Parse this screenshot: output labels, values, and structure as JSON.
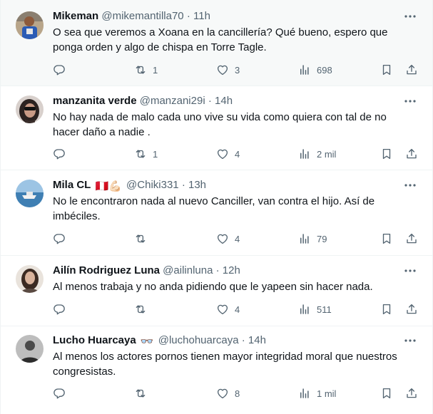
{
  "tweets": [
    {
      "name": "Mikeman",
      "handle": "@mikemantilla70",
      "time": "11h",
      "text": "O sea que veremos a Xoana en la cancillería? Qué bueno, espero que ponga orden y algo de chispa en Torre Tagle.",
      "replies": "",
      "retweets": "1",
      "likes": "3",
      "views": "698",
      "avatar": "avatar-man-blue"
    },
    {
      "name": "manzanita verde",
      "handle": "@manzani29i",
      "time": "14h",
      "text": "No hay nada de malo cada uno vive su vida como quiera con tal de no hacer daño a nadie .",
      "replies": "",
      "retweets": "1",
      "likes": "4",
      "views": "2 mil",
      "avatar": "avatar-woman-sunglasses"
    },
    {
      "name": "Mila CL",
      "name_emoji": "🇵🇪💪🏻",
      "handle": "@Chiki331",
      "time": "13h",
      "text": "No le encontraron nada al nuevo Canciller, van contra el hijo. Así de imbéciles.",
      "replies": "",
      "retweets": "",
      "likes": "4",
      "views": "79",
      "avatar": "avatar-boat-sea"
    },
    {
      "name": "Ailín Rodriguez Luna",
      "handle": "@ailinluna",
      "time": "12h",
      "text": "Al menos trabaja y no anda pidiendo que le yapeen sin hacer nada.",
      "replies": "",
      "retweets": "",
      "likes": "4",
      "views": "511",
      "avatar": "avatar-woman-portrait"
    },
    {
      "name": "Lucho Huarcaya",
      "name_emoji": "👓",
      "handle": "@luchohuarcaya",
      "time": "14h",
      "text": "Al menos los actores pornos tienen mayor integridad moral que nuestros congresistas.",
      "replies": "",
      "retweets": "",
      "likes": "8",
      "views": "1 mil",
      "avatar": "avatar-bw-portrait"
    }
  ],
  "separator": "·",
  "icons": [
    "more-icon",
    "reply-icon",
    "retweet-icon",
    "like-icon",
    "views-icon",
    "bookmark-icon",
    "share-icon"
  ],
  "colors": {
    "text": "#0f1419",
    "secondary": "#536471",
    "border": "#eff3f4",
    "hover_bg": "#f7f9f9"
  }
}
